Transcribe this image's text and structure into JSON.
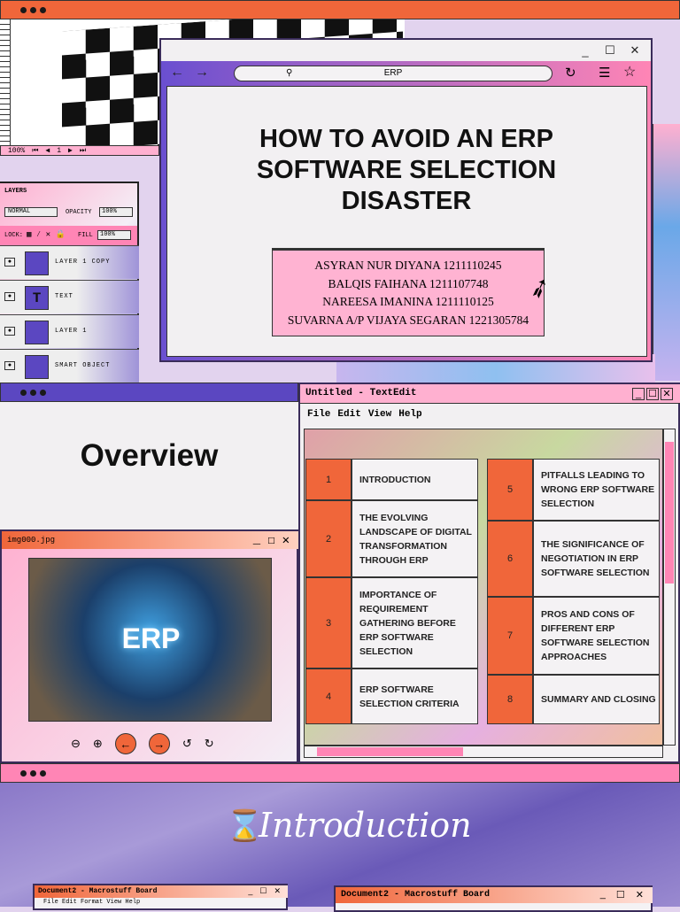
{
  "slide1": {
    "title": "HOW TO AVOID AN ERP SOFTWARE SELECTION DISASTER",
    "search": "ERP",
    "authors": [
      "ASYRAN NUR DIYANA 1211110245",
      "BALQIS FAIHANA 1211107748",
      "NAREESA IMANINA 1211110125",
      "SUVARNA A/P VIJAYA SEGARAN 1221305784"
    ],
    "toolbar": {
      "zoom": "100%",
      "page": "1"
    },
    "layers": {
      "title": "LAYERS",
      "blend": "NORMAL",
      "opacity_label": "OPACITY",
      "opacity": "100%",
      "lock_label": "LOCK:",
      "fill_label": "FILL",
      "fill": "100%",
      "items": [
        "LAYER 1 COPY",
        "TEXT",
        "LAYER 1",
        "SMART OBJECT"
      ],
      "text_glyph": "T"
    }
  },
  "slide2": {
    "heading": "Overview",
    "textedit": {
      "title": "Untitled - TextEdit",
      "menu": [
        "File",
        "Edit",
        "View",
        "Help"
      ]
    },
    "toc_left": [
      {
        "n": "1",
        "t": "INTRODUCTION"
      },
      {
        "n": "2",
        "t": "THE EVOLVING LANDSCAPE OF DIGITAL TRANSFORMATION THROUGH ERP"
      },
      {
        "n": "3",
        "t": "IMPORTANCE OF REQUIREMENT GATHERING BEFORE ERP SOFTWARE SELECTION"
      },
      {
        "n": "4",
        "t": "ERP SOFTWARE SELECTION CRITERIA"
      }
    ],
    "toc_right": [
      {
        "n": "5",
        "t": "PITFALLS LEADING TO WRONG ERP SOFTWARE SELECTION"
      },
      {
        "n": "6",
        "t": "THE SIGNIFICANCE OF NEGOTIATION IN ERP SOFTWARE SELECTION"
      },
      {
        "n": "7",
        "t": "PROS AND CONS OF DIFFERENT ERP SOFTWARE SELECTION APPROACHES"
      },
      {
        "n": "8",
        "t": "SUMMARY AND CLOSING"
      }
    ],
    "image_window": {
      "title": "img000.jpg",
      "image_text": "ERP"
    }
  },
  "slide3": {
    "heading": "Introduction",
    "win1": {
      "title": "Document2 - Macrostuff Board",
      "menu": "File Edit Format View Help"
    },
    "win2": {
      "title": "Document2 - Macrostuff Board"
    }
  },
  "colors": {
    "orange": "#f0663a",
    "pink": "#ff85b5",
    "purple": "#5b47c1"
  }
}
